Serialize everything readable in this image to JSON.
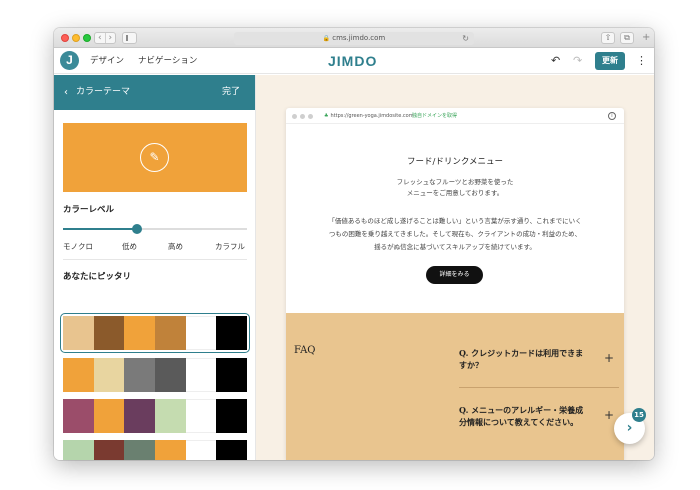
{
  "browser": {
    "url": "cms.jimdo.com"
  },
  "toolbar": {
    "logo": "J",
    "design": "デザイン",
    "navigation": "ナビゲーション",
    "brand": "JIMDO",
    "update": "更新",
    "undo_icon": "undo-icon",
    "redo_icon": "redo-icon"
  },
  "panel": {
    "back_icon": "chevron-left-icon",
    "title": "カラーテーマ",
    "done": "完了",
    "preview_color": "#F0A23A",
    "color_level_title": "カラーレベル",
    "color_level_value": 0.4,
    "levels": [
      "モノクロ",
      "低め",
      "高め",
      "カラフル"
    ],
    "suggest_title": "あなたにピッタリ",
    "palettes": [
      {
        "colors": [
          "#E8C48F",
          "#8B5A2B",
          "#F0A23A",
          "#C0823A",
          "#FFFFFF",
          "#000000"
        ],
        "selected": true
      },
      {
        "colors": [
          "#F0A23A",
          "#E8D5A0",
          "#7A7A7A",
          "#5A5A5A",
          "#FFFFFF",
          "#000000"
        ],
        "selected": false
      },
      {
        "colors": [
          "#9B4D6A",
          "#F0A23A",
          "#6A3D5E",
          "#C5DCB0",
          "#FFFFFF",
          "#000000"
        ],
        "selected": false
      },
      {
        "colors": [
          "#B5D5AC",
          "#7A3A30",
          "#6A8070",
          "#F0A23A",
          "#FFFFFF",
          "#000000"
        ],
        "selected": false
      }
    ]
  },
  "site": {
    "url": "https://green-yoga.jimdosite.com",
    "domain_link": "独自ドメインを取得",
    "menu_title": "フード/ドリンクメニュー",
    "menu_sub": [
      "フレッシュなフルーツとお野菜を使った",
      "メニューをご用意しております。"
    ],
    "menu_body": [
      "「価値あるものほど成し遂げることは難しい」という言葉が示す通り、これまでにいく",
      "つもの困難を乗り越えてきました。そして現在も、クライアントの成功・利益のため、",
      "揺るがぬ信念に基づいてスキルアップを続けています。"
    ],
    "detail_button": "詳細をみる",
    "faq_label": "FAQ",
    "faq_questions": [
      [
        "Q. クレジットカードは利用できま",
        "すか？"
      ],
      [
        "Q. メニューのアレルギー・栄養成",
        "分情報について教えてください。"
      ]
    ]
  },
  "fab": {
    "badge": "15"
  }
}
